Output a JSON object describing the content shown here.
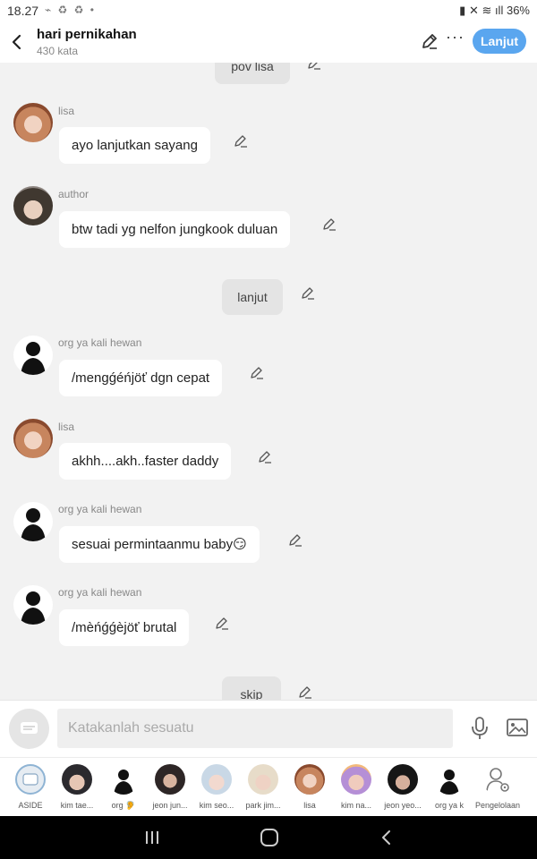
{
  "status_bar": {
    "time": "18.27",
    "battery": "36%"
  },
  "header": {
    "title": "hari pernikahan",
    "word_count": "430 kata",
    "continue_button": "Lanjut"
  },
  "messages": {
    "m0": {
      "text": "pov lisa"
    },
    "m1": {
      "name": "lisa",
      "text": "ayo lanjutkan sayang"
    },
    "m2": {
      "name": "author",
      "text": "btw tadi yg nelfon jungkook duluan"
    },
    "m3": {
      "text": "lanjut"
    },
    "m4": {
      "name": "org ya kali hewan",
      "text": "/mengǵéńjöť dgn cepat"
    },
    "m5": {
      "name": "lisa",
      "text": "akhh....akh..faster daddy"
    },
    "m6": {
      "name": "org ya kali hewan",
      "text": "sesuai permintaanmu baby😏"
    },
    "m7": {
      "name": "org ya kali hewan",
      "text": "/mèńǵǵèjöť brutal"
    },
    "m8": {
      "text": "skip"
    }
  },
  "input": {
    "placeholder": "Katakanlah sesuatu"
  },
  "characters": [
    {
      "label": "ASIDE"
    },
    {
      "label": "kim tae..."
    },
    {
      "label": "org 🦻"
    },
    {
      "label": "jeon jun..."
    },
    {
      "label": "kim seo..."
    },
    {
      "label": "park jim..."
    },
    {
      "label": "lisa"
    },
    {
      "label": "kim na..."
    },
    {
      "label": "jeon yeo..."
    },
    {
      "label": "org ya k"
    },
    {
      "label": "Pengelolaan"
    }
  ],
  "colors": {
    "accent": "#5aa6ef",
    "chat_background": "#f2f2f2"
  }
}
